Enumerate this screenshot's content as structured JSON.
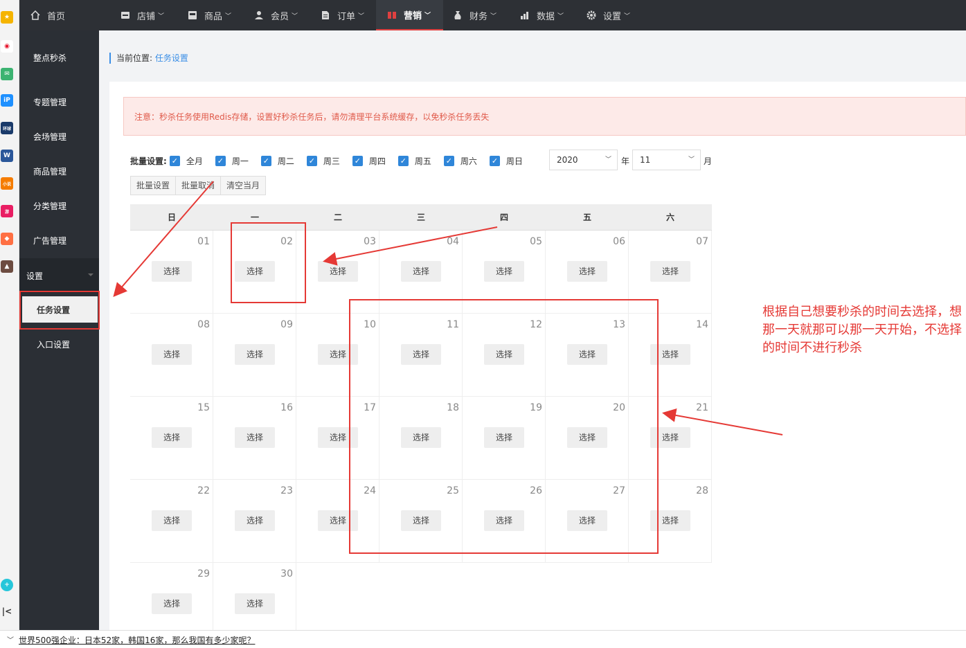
{
  "nav": {
    "home": "首页",
    "items": [
      "店铺",
      "商品",
      "会员",
      "订单",
      "营销",
      "财务",
      "数据",
      "设置"
    ]
  },
  "sidebar": {
    "items": [
      "整点秒杀",
      "专题管理",
      "会场管理",
      "商品管理",
      "分类管理",
      "广告管理"
    ],
    "group": "设置",
    "sub": [
      "任务设置",
      "入口设置"
    ]
  },
  "breadcrumb": {
    "prefix": "当前位置:",
    "current": "任务设置"
  },
  "alert": "注意：秒杀任务使用Redis存储，设置好秒杀任务后，请勿清理平台系统缓存，以免秒杀任务丢失",
  "batch": {
    "label": "批量设置:",
    "options": [
      "全月",
      "周一",
      "周二",
      "周三",
      "周四",
      "周五",
      "周六",
      "周日"
    ],
    "year": "2020",
    "year_unit": "年",
    "month": "11",
    "month_unit": "月",
    "buttons": [
      "批量设置",
      "批量取消",
      "清空当月"
    ]
  },
  "calendar": {
    "weekdays": [
      "日",
      "一",
      "二",
      "三",
      "四",
      "五",
      "六"
    ],
    "days": [
      "01",
      "02",
      "03",
      "04",
      "05",
      "06",
      "07",
      "08",
      "09",
      "10",
      "11",
      "12",
      "13",
      "14",
      "15",
      "16",
      "17",
      "18",
      "19",
      "20",
      "21",
      "22",
      "23",
      "24",
      "25",
      "26",
      "27",
      "28",
      "29",
      "30"
    ],
    "select_label": "选择"
  },
  "annotation": "根据自己想要秒杀的时间去选择，想那一天就那可以那一天开始，不选择的时间不进行秒杀",
  "footer_news": "世界500强企业：日本52家，韩国16家，那么我国有多少家呢？",
  "colors": {
    "accent_red": "#e53935",
    "link_blue": "#3a8ee6",
    "checkbox_blue": "#2f86d9",
    "topbar": "#2d3035"
  }
}
